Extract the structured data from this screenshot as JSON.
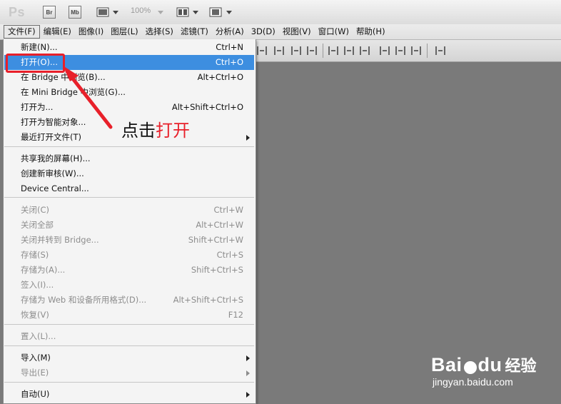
{
  "app": {
    "logo": "Ps",
    "toolbar": {
      "br": "Br",
      "mb": "Mb",
      "zoom": "100%"
    }
  },
  "menubar": [
    {
      "label": "文件(F)",
      "active": true
    },
    {
      "label": "编辑(E)"
    },
    {
      "label": "图像(I)"
    },
    {
      "label": "图层(L)"
    },
    {
      "label": "选择(S)"
    },
    {
      "label": "滤镜(T)"
    },
    {
      "label": "分析(A)"
    },
    {
      "label": "3D(D)"
    },
    {
      "label": "视图(V)"
    },
    {
      "label": "窗口(W)"
    },
    {
      "label": "帮助(H)"
    }
  ],
  "file_menu": {
    "items": [
      {
        "label": "新建(N)...",
        "shortcut": "Ctrl+N"
      },
      {
        "label": "打开(O)...",
        "shortcut": "Ctrl+O",
        "highlighted": true
      },
      {
        "label": "在 Bridge 中浏览(B)...",
        "shortcut": "Alt+Ctrl+O"
      },
      {
        "label": "在 Mini Bridge 中浏览(G)...",
        "shortcut": ""
      },
      {
        "label": "打开为...",
        "shortcut": "Alt+Shift+Ctrl+O"
      },
      {
        "label": "打开为智能对象...",
        "shortcut": ""
      },
      {
        "label": "最近打开文件(T)",
        "shortcut": "",
        "submenu": true
      },
      {
        "label": "共享我的屏幕(H)...",
        "shortcut": ""
      },
      {
        "label": "创建新审核(W)...",
        "shortcut": ""
      },
      {
        "label": "Device Central...",
        "shortcut": ""
      },
      {
        "label": "关闭(C)",
        "shortcut": "Ctrl+W",
        "disabled": true
      },
      {
        "label": "关闭全部",
        "shortcut": "Alt+Ctrl+W",
        "disabled": true
      },
      {
        "label": "关闭并转到 Bridge...",
        "shortcut": "Shift+Ctrl+W",
        "disabled": true
      },
      {
        "label": "存储(S)",
        "shortcut": "Ctrl+S",
        "disabled": true
      },
      {
        "label": "存储为(A)...",
        "shortcut": "Shift+Ctrl+S",
        "disabled": true
      },
      {
        "label": "签入(I)...",
        "shortcut": "",
        "disabled": true
      },
      {
        "label": "存储为 Web 和设备所用格式(D)...",
        "shortcut": "Alt+Shift+Ctrl+S",
        "disabled": true
      },
      {
        "label": "恢复(V)",
        "shortcut": "F12",
        "disabled": true
      },
      {
        "label": "置入(L)...",
        "shortcut": "",
        "disabled": true
      },
      {
        "label": "导入(M)",
        "shortcut": "",
        "submenu": true
      },
      {
        "label": "导出(E)",
        "shortcut": "",
        "submenu": true,
        "disabled": true
      },
      {
        "label": "自动(U)",
        "shortcut": "",
        "submenu": true
      }
    ]
  },
  "annotation": {
    "prefix": "点击",
    "highlight": "打开",
    "highlight_color": "#e8202a"
  },
  "colors": {
    "accent": "#3d8ee0",
    "canvas": "#7a7a7a",
    "annotation": "#e8202a"
  },
  "watermark": {
    "logo_left": "Bai",
    "logo_right": "du",
    "cn": "经验",
    "url": "jingyan.baidu.com"
  }
}
